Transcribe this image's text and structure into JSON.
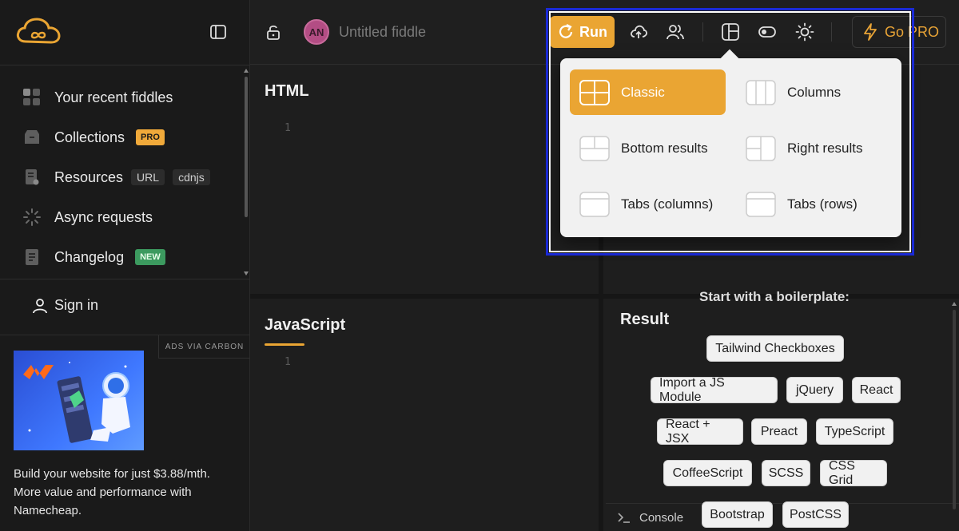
{
  "sidebar": {
    "items": [
      {
        "label": "Your recent fiddles",
        "icon": "grid-icon"
      },
      {
        "label": "Collections",
        "icon": "box-icon",
        "badge": "PRO"
      },
      {
        "label": "Resources",
        "icon": "file-icon",
        "tags": [
          "URL",
          "cdnjs"
        ]
      },
      {
        "label": "Async requests",
        "icon": "spinner-icon"
      },
      {
        "label": "Changelog",
        "icon": "doc-icon",
        "badge": "NEW"
      }
    ],
    "sign_in": "Sign in",
    "ads_label": "ADS VIA CARBON",
    "ad_text": "Build your website for just $3.88/mth. More value and performance with Namecheap."
  },
  "header": {
    "avatar_initials": "AN",
    "fiddle_title": "Untitled fiddle",
    "run_label": "Run",
    "go_pro_label": "Go PRO"
  },
  "editor": {
    "html_title": "HTML",
    "js_title": "JavaScript",
    "result_title": "Result",
    "line_number": "1"
  },
  "layout_menu": {
    "options": [
      {
        "label": "Classic",
        "active": true
      },
      {
        "label": "Columns",
        "active": false
      },
      {
        "label": "Bottom results",
        "active": false
      },
      {
        "label": "Right results",
        "active": false
      },
      {
        "label": "Tabs (columns)",
        "active": false
      },
      {
        "label": "Tabs (rows)",
        "active": false
      }
    ]
  },
  "result": {
    "boilerplate_heading": "Start with a boilerplate:",
    "boilerplates": [
      "Tailwind Checkboxes",
      "Import a JS Module",
      "jQuery",
      "React",
      "React + JSX",
      "Preact",
      "TypeScript",
      "CoffeeScript",
      "SCSS",
      "CSS Grid",
      "Bootstrap",
      "PostCSS"
    ]
  },
  "console": {
    "label": "Console"
  },
  "colors": {
    "accent": "#eaa533",
    "background": "#1f1f1f",
    "highlight": "#1a2ad6"
  }
}
